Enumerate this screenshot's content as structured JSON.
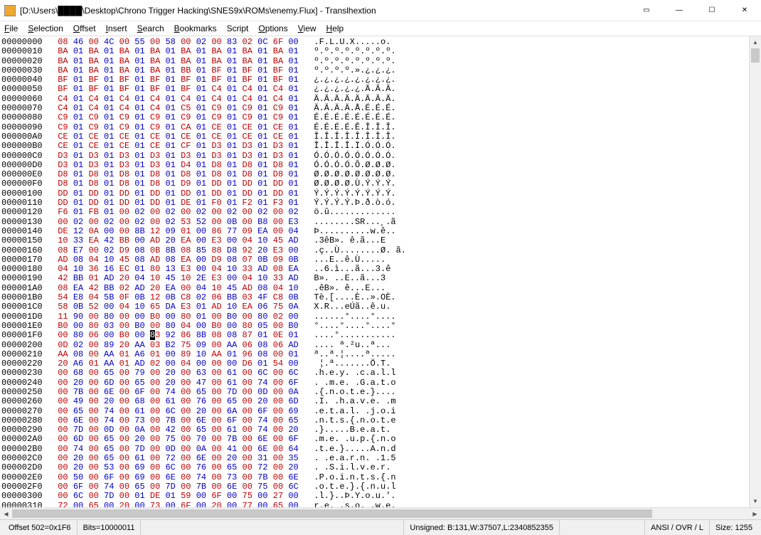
{
  "window": {
    "title": "[D:\\Users\\████\\Desktop\\Chrono Trigger Hacking\\SNES9x\\ROMs\\enemy.Flux] - Translhextion"
  },
  "menu": {
    "file": "File",
    "selection": "Selection",
    "offset": "Offset",
    "insert": "Insert",
    "search": "Search",
    "bookmarks": "Bookmarks",
    "script": "Script",
    "options": "Options",
    "view": "View",
    "help": "Help"
  },
  "status": {
    "offset": "Offset 502=0x1F6",
    "bits": "Bits=10000011",
    "unsigned": "Unsigned: B:131,W:37507,L:2340852355",
    "mode": "ANSI / OVR / L",
    "size": "Size: 1255"
  },
  "cursor": {
    "row": 31,
    "col": 6
  },
  "rows": [
    {
      "o": "00000000",
      "h": [
        "08",
        "46",
        "00",
        "4C",
        "00",
        "55",
        "00",
        "58",
        "00",
        "02",
        "00",
        "83",
        "02",
        "0C",
        "6F",
        "00"
      ],
      "a": ".F.L.U.X.....o."
    },
    {
      "o": "00000010",
      "h": [
        "BA",
        "01",
        "BA",
        "01",
        "BA",
        "01",
        "BA",
        "01",
        "BA",
        "01",
        "BA",
        "01",
        "BA",
        "01",
        "BA",
        "01"
      ],
      "a": "º.º.º.º.º.º.º.º."
    },
    {
      "o": "00000020",
      "h": [
        "BA",
        "01",
        "BA",
        "01",
        "BA",
        "01",
        "BA",
        "01",
        "BA",
        "01",
        "BA",
        "01",
        "BA",
        "01",
        "BA",
        "01"
      ],
      "a": "º.º.º.º.º.º.º.º."
    },
    {
      "o": "00000030",
      "h": [
        "BA",
        "01",
        "BA",
        "01",
        "BA",
        "01",
        "BA",
        "01",
        "BB",
        "01",
        "BF",
        "01",
        "BF",
        "01",
        "BF",
        "01"
      ],
      "a": "º.º.º.º.».¿.¿.¿."
    },
    {
      "o": "00000040",
      "h": [
        "BF",
        "01",
        "BF",
        "01",
        "BF",
        "01",
        "BF",
        "01",
        "BF",
        "01",
        "BF",
        "01",
        "BF",
        "01",
        "BF",
        "01"
      ],
      "a": "¿.¿.¿.¿.¿.¿.¿.¿."
    },
    {
      "o": "00000050",
      "h": [
        "BF",
        "01",
        "BF",
        "01",
        "BF",
        "01",
        "BF",
        "01",
        "BF",
        "01",
        "C4",
        "01",
        "C4",
        "01",
        "C4",
        "01"
      ],
      "a": "¿.¿.¿.¿.¿.Ä.Ä.Ä."
    },
    {
      "o": "00000060",
      "h": [
        "C4",
        "01",
        "C4",
        "01",
        "C4",
        "01",
        "C4",
        "01",
        "C4",
        "01",
        "C4",
        "01",
        "C4",
        "01",
        "C4",
        "01"
      ],
      "a": "Ä.Ä.Ä.Ä.Ä.Ä.Ä.Ä."
    },
    {
      "o": "00000070",
      "h": [
        "C4",
        "01",
        "C4",
        "01",
        "C4",
        "01",
        "C4",
        "01",
        "C5",
        "01",
        "C9",
        "01",
        "C9",
        "01",
        "C9",
        "01"
      ],
      "a": "Ä.Ä.Ä.Ä.Å.É.É.É."
    },
    {
      "o": "00000080",
      "h": [
        "C9",
        "01",
        "C9",
        "01",
        "C9",
        "01",
        "C9",
        "01",
        "C9",
        "01",
        "C9",
        "01",
        "C9",
        "01",
        "C9",
        "01"
      ],
      "a": "É.É.É.É.É.É.É.É."
    },
    {
      "o": "00000090",
      "h": [
        "C9",
        "01",
        "C9",
        "01",
        "C9",
        "01",
        "C9",
        "01",
        "CA",
        "01",
        "CE",
        "01",
        "CE",
        "01",
        "CE",
        "01"
      ],
      "a": "É.É.É.É.Ê.Î.Î.Î."
    },
    {
      "o": "000000A0",
      "h": [
        "CE",
        "01",
        "CE",
        "01",
        "CE",
        "01",
        "CE",
        "01",
        "CE",
        "01",
        "CE",
        "01",
        "CE",
        "01",
        "CE",
        "01"
      ],
      "a": "Î.Î.Î.Î.Î.Î.Î.Î."
    },
    {
      "o": "000000B0",
      "h": [
        "CE",
        "01",
        "CE",
        "01",
        "CE",
        "01",
        "CE",
        "01",
        "CF",
        "01",
        "D3",
        "01",
        "D3",
        "01",
        "D3",
        "01"
      ],
      "a": "Î.Î.Î.Î.Ï.Ó.Ó.Ó."
    },
    {
      "o": "000000C0",
      "h": [
        "D3",
        "01",
        "D3",
        "01",
        "D3",
        "01",
        "D3",
        "01",
        "D3",
        "01",
        "D3",
        "01",
        "D3",
        "01",
        "D3",
        "01"
      ],
      "a": "Ó.Ó.Ó.Ó.Ó.Ó.Ó.Ó."
    },
    {
      "o": "000000D0",
      "h": [
        "D3",
        "01",
        "D3",
        "01",
        "D3",
        "01",
        "D3",
        "01",
        "D4",
        "01",
        "D8",
        "01",
        "D8",
        "01",
        "D8",
        "01"
      ],
      "a": "Ó.Ó.Ó.Ó.Ô.Ø.Ø.Ø."
    },
    {
      "o": "000000E0",
      "h": [
        "D8",
        "01",
        "D8",
        "01",
        "D8",
        "01",
        "D8",
        "01",
        "D8",
        "01",
        "D8",
        "01",
        "D8",
        "01",
        "D8",
        "01"
      ],
      "a": "Ø.Ø.Ø.Ø.Ø.Ø.Ø.Ø."
    },
    {
      "o": "000000F0",
      "h": [
        "D8",
        "01",
        "D8",
        "01",
        "D8",
        "01",
        "D8",
        "01",
        "D9",
        "01",
        "DD",
        "01",
        "DD",
        "01",
        "DD",
        "01"
      ],
      "a": "Ø.Ø.Ø.Ø.Ù.Ý.Ý.Ý."
    },
    {
      "o": "00000100",
      "h": [
        "DD",
        "01",
        "DD",
        "01",
        "DD",
        "01",
        "DD",
        "01",
        "DD",
        "01",
        "DD",
        "01",
        "DD",
        "01",
        "DD",
        "01"
      ],
      "a": "Ý.Ý.Ý.Ý.Ý.Ý.Ý.Ý."
    },
    {
      "o": "00000110",
      "h": [
        "DD",
        "01",
        "DD",
        "01",
        "DD",
        "01",
        "DD",
        "01",
        "DE",
        "01",
        "F0",
        "01",
        "F2",
        "01",
        "F3",
        "01"
      ],
      "a": "Ý.Ý.Ý.Ý.Þ.ð.ò.ó."
    },
    {
      "o": "00000120",
      "h": [
        "F6",
        "01",
        "FB",
        "01",
        "00",
        "02",
        "00",
        "02",
        "00",
        "02",
        "00",
        "02",
        "00",
        "02",
        "00",
        "02"
      ],
      "a": "ö.û............."
    },
    {
      "o": "00000130",
      "h": [
        "00",
        "02",
        "00",
        "02",
        "00",
        "02",
        "00",
        "02",
        "53",
        "52",
        "00",
        "0B",
        "00",
        "B8",
        "00",
        "E3"
      ],
      "a": "........SR...¸.ã"
    },
    {
      "o": "00000140",
      "h": [
        "DE",
        "12",
        "0A",
        "00",
        "00",
        "8B",
        "12",
        "09",
        "01",
        "00",
        "86",
        "77",
        "09",
        "EA",
        "00",
        "04"
      ],
      "a": "Þ..........w.ê.."
    },
    {
      "o": "00000150",
      "h": [
        "10",
        "33",
        "EA",
        "42",
        "BB",
        "00",
        "AD",
        "20",
        "EA",
        "00",
        "E3",
        "00",
        "04",
        "10",
        "45",
        "AD"
      ],
      "a": ".3êB».­ ê.ã...E­"
    },
    {
      "o": "00000160",
      "h": [
        "08",
        "E7",
        "00",
        "02",
        "D9",
        "08",
        "0B",
        "8B",
        "08",
        "85",
        "88",
        "D8",
        "92",
        "20",
        "E3",
        "00"
      ],
      "a": ".ç..Ù........Ø. ã."
    },
    {
      "o": "00000170",
      "h": [
        "AD",
        "08",
        "04",
        "10",
        "45",
        "08",
        "AD",
        "08",
        "EA",
        "00",
        "D9",
        "08",
        "07",
        "0B",
        "09",
        "0B"
      ],
      "a": "­...E.­.ê.Ù....."
    },
    {
      "o": "00000180",
      "h": [
        "04",
        "10",
        "36",
        "16",
        "EC",
        "01",
        "80",
        "13",
        "E3",
        "00",
        "04",
        "10",
        "33",
        "AD",
        "08",
        "EA"
      ],
      "a": "..6.ì...ã...3­.ê"
    },
    {
      "o": "00000190",
      "h": [
        "42",
        "BB",
        "01",
        "AD",
        "20",
        "04",
        "10",
        "45",
        "10",
        "2E",
        "E3",
        "00",
        "04",
        "10",
        "33",
        "AD"
      ],
      "a": "B».­ ..E..ã...3­"
    },
    {
      "o": "000001A0",
      "h": [
        "08",
        "EA",
        "42",
        "BB",
        "02",
        "AD",
        "20",
        "EA",
        "00",
        "04",
        "10",
        "45",
        "AD",
        "08",
        "04",
        "10"
      ],
      "a": ".êB».­ ê...E­..."
    },
    {
      "o": "000001B0",
      "h": [
        "54",
        "E8",
        "04",
        "5B",
        "0F",
        "0B",
        "12",
        "0B",
        "C8",
        "02",
        "06",
        "BB",
        "03",
        "4F",
        "C8",
        "0B"
      ],
      "a": "Tè.[....È..».OÈ."
    },
    {
      "o": "000001C0",
      "h": [
        "58",
        "0B",
        "52",
        "00",
        "04",
        "10",
        "65",
        "DA",
        "E3",
        "01",
        "AD",
        "10",
        "EA",
        "06",
        "75",
        "0A"
      ],
      "a": "X.R...eÚã.­.ê.u."
    },
    {
      "o": "000001D0",
      "h": [
        "11",
        "90",
        "00",
        "80",
        "00",
        "00",
        "B0",
        "00",
        "80",
        "01",
        "00",
        "B0",
        "00",
        "80",
        "02",
        "00"
      ],
      "a": "......°....°...."
    },
    {
      "o": "000001E0",
      "h": [
        "B0",
        "00",
        "80",
        "03",
        "00",
        "B0",
        "00",
        "80",
        "04",
        "00",
        "B0",
        "00",
        "80",
        "05",
        "00",
        "B0"
      ],
      "a": "°....°....°....°"
    },
    {
      "o": "000001F0",
      "h": [
        "00",
        "80",
        "06",
        "00",
        "B0",
        "00",
        "83",
        "92",
        "86",
        "8B",
        "08",
        "08",
        "87",
        "01",
        "0E",
        "01"
      ],
      "a": "....°..........."
    },
    {
      "o": "00000200",
      "h": [
        "0D",
        "02",
        "00",
        "89",
        "20",
        "AA",
        "03",
        "B2",
        "75",
        "09",
        "00",
        "AA",
        "06",
        "08",
        "06",
        "AD"
      ],
      "a": ".... ª.²u..ª...­"
    },
    {
      "o": "00000210",
      "h": [
        "AA",
        "08",
        "00",
        "AA",
        "01",
        "A6",
        "01",
        "00",
        "89",
        "10",
        "AA",
        "01",
        "96",
        "08",
        "00",
        "01"
      ],
      "a": "ª..ª.¦....ª....."
    },
    {
      "o": "00000220",
      "h": [
        "20",
        "A6",
        "01",
        "AA",
        "01",
        "AD",
        "02",
        "00",
        "04",
        "00",
        "00",
        "00",
        "D6",
        "01",
        "54",
        "00"
      ],
      "a": " ¦.ª.­......Ö.T."
    },
    {
      "o": "00000230",
      "h": [
        "00",
        "68",
        "00",
        "65",
        "00",
        "79",
        "00",
        "20",
        "00",
        "63",
        "00",
        "61",
        "00",
        "6C",
        "00",
        "6C"
      ],
      "a": ".h.e.y. .c.a.l.l"
    },
    {
      "o": "00000240",
      "h": [
        "00",
        "20",
        "00",
        "6D",
        "00",
        "65",
        "00",
        "20",
        "00",
        "47",
        "00",
        "61",
        "00",
        "74",
        "00",
        "6F"
      ],
      "a": ". .m.e. .G.a.t.o"
    },
    {
      "o": "00000250",
      "h": [
        "00",
        "7B",
        "00",
        "6E",
        "00",
        "6F",
        "00",
        "74",
        "00",
        "65",
        "00",
        "7D",
        "00",
        "0D",
        "00",
        "0A"
      ],
      "a": ".{.n.o.t.e.}...."
    },
    {
      "o": "00000260",
      "h": [
        "00",
        "49",
        "00",
        "20",
        "00",
        "68",
        "00",
        "61",
        "00",
        "76",
        "00",
        "65",
        "00",
        "20",
        "00",
        "6D"
      ],
      "a": ".I. .h.a.v.e. .m"
    },
    {
      "o": "00000270",
      "h": [
        "00",
        "65",
        "00",
        "74",
        "00",
        "61",
        "00",
        "6C",
        "00",
        "20",
        "00",
        "6A",
        "00",
        "6F",
        "00",
        "69"
      ],
      "a": ".e.t.a.l. .j.o.i"
    },
    {
      "o": "00000280",
      "h": [
        "00",
        "6E",
        "00",
        "74",
        "00",
        "73",
        "00",
        "7B",
        "00",
        "6E",
        "00",
        "6F",
        "00",
        "74",
        "00",
        "65"
      ],
      "a": ".n.t.s.{.n.o.t.e"
    },
    {
      "o": "00000290",
      "h": [
        "00",
        "7D",
        "00",
        "0D",
        "00",
        "0A",
        "00",
        "42",
        "00",
        "65",
        "00",
        "61",
        "00",
        "74",
        "00",
        "20"
      ],
      "a": ".}.....B.e.a.t. "
    },
    {
      "o": "000002A0",
      "h": [
        "00",
        "6D",
        "00",
        "65",
        "00",
        "20",
        "00",
        "75",
        "00",
        "70",
        "00",
        "7B",
        "00",
        "6E",
        "00",
        "6F"
      ],
      "a": ".m.e. .u.p.{.n.o"
    },
    {
      "o": "000002B0",
      "h": [
        "00",
        "74",
        "00",
        "65",
        "00",
        "7D",
        "00",
        "0D",
        "00",
        "0A",
        "00",
        "41",
        "00",
        "6E",
        "00",
        "64"
      ],
      "a": ".t.e.}.....A.n.d"
    },
    {
      "o": "000002C0",
      "h": [
        "00",
        "20",
        "00",
        "65",
        "00",
        "61",
        "00",
        "72",
        "00",
        "6E",
        "00",
        "20",
        "00",
        "31",
        "00",
        "35"
      ],
      "a": ". .e.a.r.n. .1.5"
    },
    {
      "o": "000002D0",
      "h": [
        "00",
        "20",
        "00",
        "53",
        "00",
        "69",
        "00",
        "6C",
        "00",
        "76",
        "00",
        "65",
        "00",
        "72",
        "00",
        "20"
      ],
      "a": ". .S.i.l.v.e.r. "
    },
    {
      "o": "000002E0",
      "h": [
        "00",
        "50",
        "00",
        "6F",
        "00",
        "69",
        "00",
        "6E",
        "00",
        "74",
        "00",
        "73",
        "00",
        "7B",
        "00",
        "6E"
      ],
      "a": ".P.o.i.n.t.s.{.n"
    },
    {
      "o": "000002F0",
      "h": [
        "00",
        "6F",
        "00",
        "74",
        "00",
        "65",
        "00",
        "7D",
        "00",
        "7B",
        "00",
        "6E",
        "00",
        "75",
        "00",
        "6C"
      ],
      "a": ".o.t.e.}.{.n.u.l"
    },
    {
      "o": "00000300",
      "h": [
        "00",
        "6C",
        "00",
        "7D",
        "00",
        "01",
        "DE",
        "01",
        "59",
        "00",
        "6F",
        "00",
        "75",
        "00",
        "27",
        "00"
      ],
      "a": ".l.}..Þ.Y.o.u.'."
    },
    {
      "o": "00000310",
      "h": [
        "72",
        "00",
        "65",
        "00",
        "20",
        "00",
        "73",
        "00",
        "6F",
        "00",
        "20",
        "00",
        "77",
        "00",
        "65",
        "00"
      ],
      "a": "r.e. .s.o. .w.e."
    }
  ]
}
